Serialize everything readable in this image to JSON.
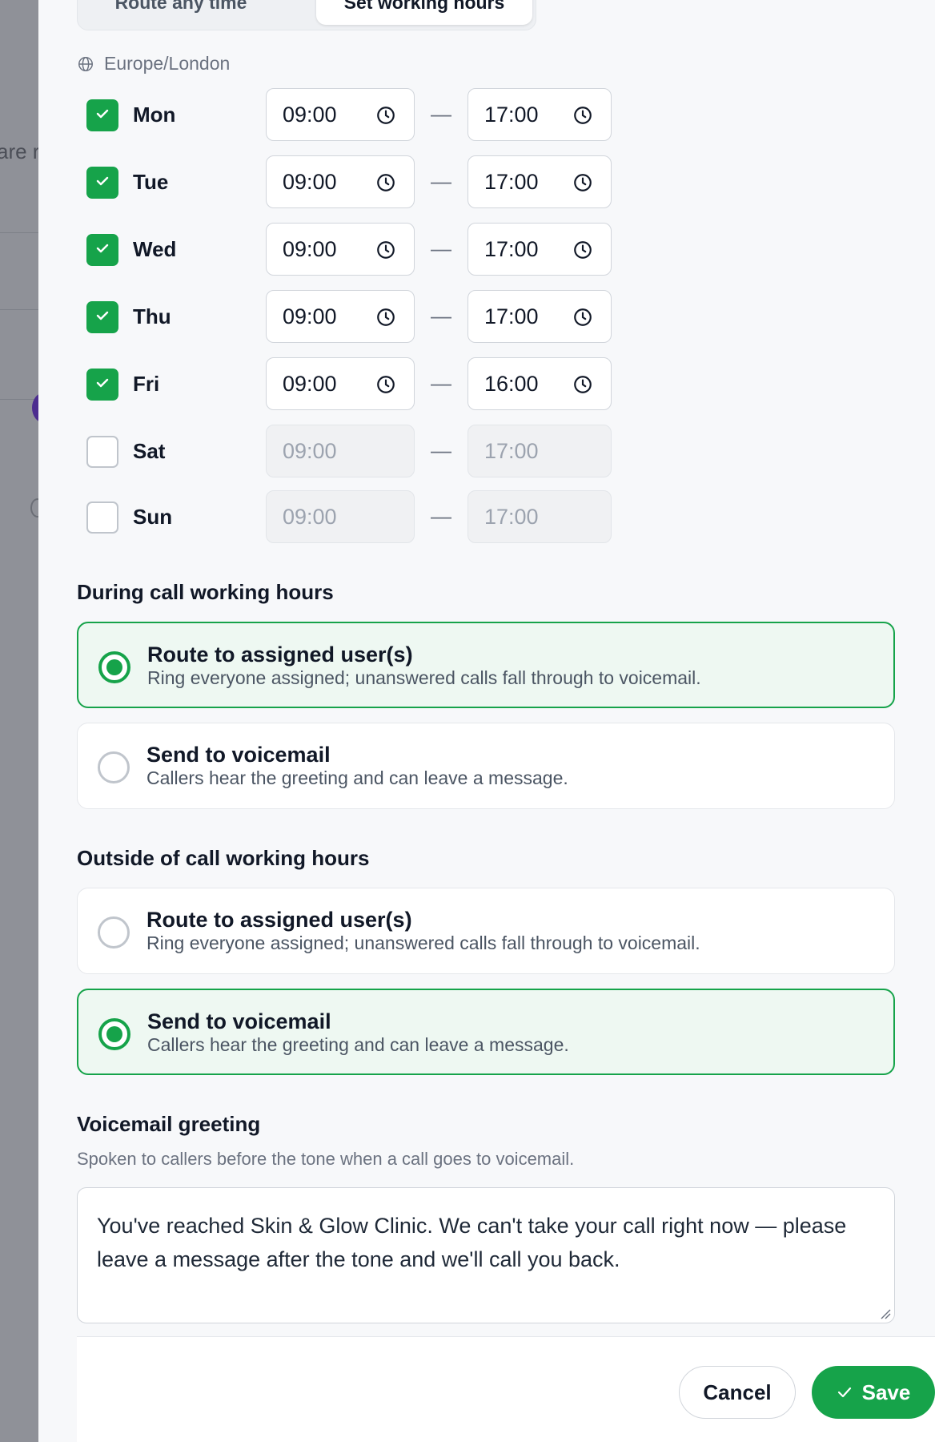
{
  "backdrop": {
    "partial_text": "are r"
  },
  "tabs": {
    "route_any_time": "Route any time",
    "set_working_hours": "Set working hours",
    "active": "set_working_hours"
  },
  "timezone": "Europe/London",
  "schedule": [
    {
      "day": "Mon",
      "enabled": true,
      "start": "09:00",
      "end": "17:00"
    },
    {
      "day": "Tue",
      "enabled": true,
      "start": "09:00",
      "end": "17:00"
    },
    {
      "day": "Wed",
      "enabled": true,
      "start": "09:00",
      "end": "17:00"
    },
    {
      "day": "Thu",
      "enabled": true,
      "start": "09:00",
      "end": "17:00"
    },
    {
      "day": "Fri",
      "enabled": true,
      "start": "09:00",
      "end": "16:00"
    },
    {
      "day": "Sat",
      "enabled": false,
      "start": "09:00",
      "end": "17:00"
    },
    {
      "day": "Sun",
      "enabled": false,
      "start": "09:00",
      "end": "17:00"
    }
  ],
  "separator": "—",
  "during": {
    "title": "During call working hours",
    "options": [
      {
        "title": "Route to assigned user(s)",
        "desc": "Ring everyone assigned; unanswered calls fall through to voicemail.",
        "selected": true
      },
      {
        "title": "Send to voicemail",
        "desc": "Callers hear the greeting and can leave a message.",
        "selected": false
      }
    ]
  },
  "outside": {
    "title": "Outside of call working hours",
    "options": [
      {
        "title": "Route to assigned user(s)",
        "desc": "Ring everyone assigned; unanswered calls fall through to voicemail.",
        "selected": false
      },
      {
        "title": "Send to voicemail",
        "desc": "Callers hear the greeting and can leave a message.",
        "selected": true
      }
    ]
  },
  "voicemail": {
    "title": "Voicemail greeting",
    "desc": "Spoken to callers before the tone when a call goes to voicemail.",
    "greeting": "You've reached Skin & Glow Clinic. We can't take your call right now — please leave a message after the tone and we'll call you back."
  },
  "footer": {
    "cancel": "Cancel",
    "save": "Save"
  },
  "colors": {
    "accent": "#16a34a",
    "selected_bg": "#eef8f2",
    "panel_bg": "#f7f8fa",
    "overlay": "#8e9097"
  },
  "icons": {
    "timezone": "globe-icon",
    "time": "clock-icon",
    "check": "check-icon"
  }
}
